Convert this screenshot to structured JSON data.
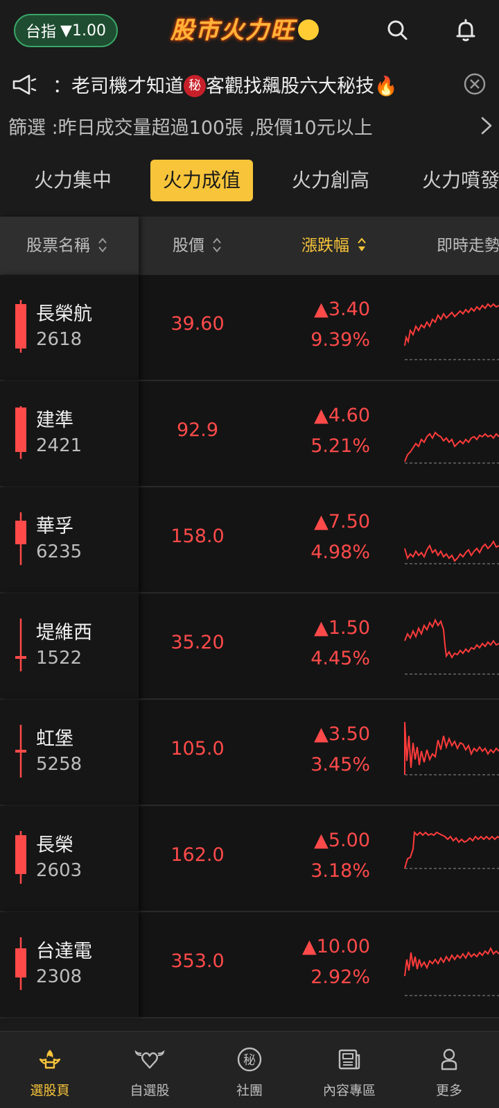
{
  "header": {
    "index_label": "台指",
    "index_change": "▼1.00",
    "app_title": "股市火力旺"
  },
  "announcement": {
    "text": "：老司機才知道",
    "badge": "秘",
    "text_after": "客觀找飆股六大秘技🔥"
  },
  "filter": {
    "text": "篩選 :昨日成交量超過100張 ,股價10元以上"
  },
  "tabs": [
    {
      "label": "火力集中",
      "active": false
    },
    {
      "label": "火力成值",
      "active": true
    },
    {
      "label": "火力創高",
      "active": false
    },
    {
      "label": "火力噴發",
      "active": false
    }
  ],
  "columns": {
    "name": "股票名稱",
    "price": "股價",
    "change": "漲跌幅",
    "trend": "即時走勢"
  },
  "rows": [
    {
      "name": "長榮航",
      "code": "2618",
      "price": "39.60",
      "change": "▲3.40",
      "pct": "9.39%"
    },
    {
      "name": "建準",
      "code": "2421",
      "price": "92.9",
      "change": "▲4.60",
      "pct": "5.21%"
    },
    {
      "name": "華孚",
      "code": "6235",
      "price": "158.0",
      "change": "▲7.50",
      "pct": "4.98%"
    },
    {
      "name": "堤維西",
      "code": "1522",
      "price": "35.20",
      "change": "▲1.50",
      "pct": "4.45%"
    },
    {
      "name": "虹堡",
      "code": "5258",
      "price": "105.0",
      "change": "▲3.50",
      "pct": "3.45%"
    },
    {
      "name": "長榮",
      "code": "2603",
      "price": "162.0",
      "change": "▲5.00",
      "pct": "3.18%"
    },
    {
      "name": "台達電",
      "code": "2308",
      "price": "353.0",
      "change": "▲10.00",
      "pct": "2.92%"
    }
  ],
  "nav": [
    {
      "label": "選股頁",
      "icon": "stock-picker-icon",
      "active": true
    },
    {
      "label": "自選股",
      "icon": "winged-heart-icon",
      "active": false
    },
    {
      "label": "社團",
      "icon": "secret-club-icon",
      "active": false
    },
    {
      "label": "內容專區",
      "icon": "newspaper-icon",
      "active": false
    },
    {
      "label": "更多",
      "icon": "person-icon",
      "active": false
    }
  ],
  "colors": {
    "accent": "#f8c53a",
    "up": "#ff4a4a",
    "index_pill": "#1f4d31"
  }
}
